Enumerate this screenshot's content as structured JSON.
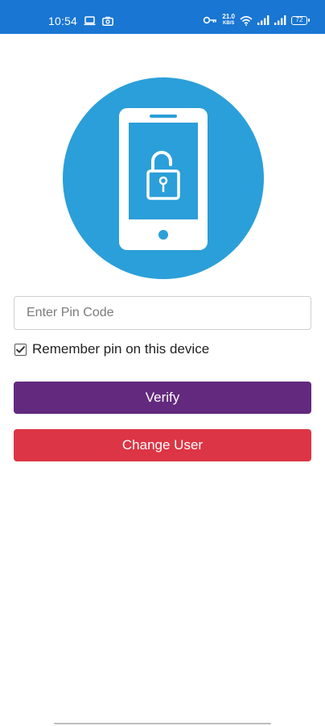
{
  "status_bar": {
    "time": "10:54",
    "speed_top": "21.0",
    "speed_bottom": "KB/S",
    "battery": "72",
    "left_icons": [
      "laptop-icon",
      "camera-icon"
    ],
    "right_icons": [
      "vpn-key-icon",
      "network-speed",
      "wifi-icon",
      "signal-icon",
      "signal-icon",
      "battery-icon"
    ],
    "background": "#1976d2"
  },
  "hero": {
    "icon": "phone-unlock-icon",
    "circle_color": "#2b9fd9"
  },
  "pin_input": {
    "placeholder": "Enter Pin Code",
    "value": ""
  },
  "remember": {
    "label": "Remember pin on this device",
    "checked": true
  },
  "buttons": {
    "verify": "Verify",
    "change_user": "Change User"
  },
  "colors": {
    "verify": "#63297e",
    "change_user": "#dc3545"
  }
}
